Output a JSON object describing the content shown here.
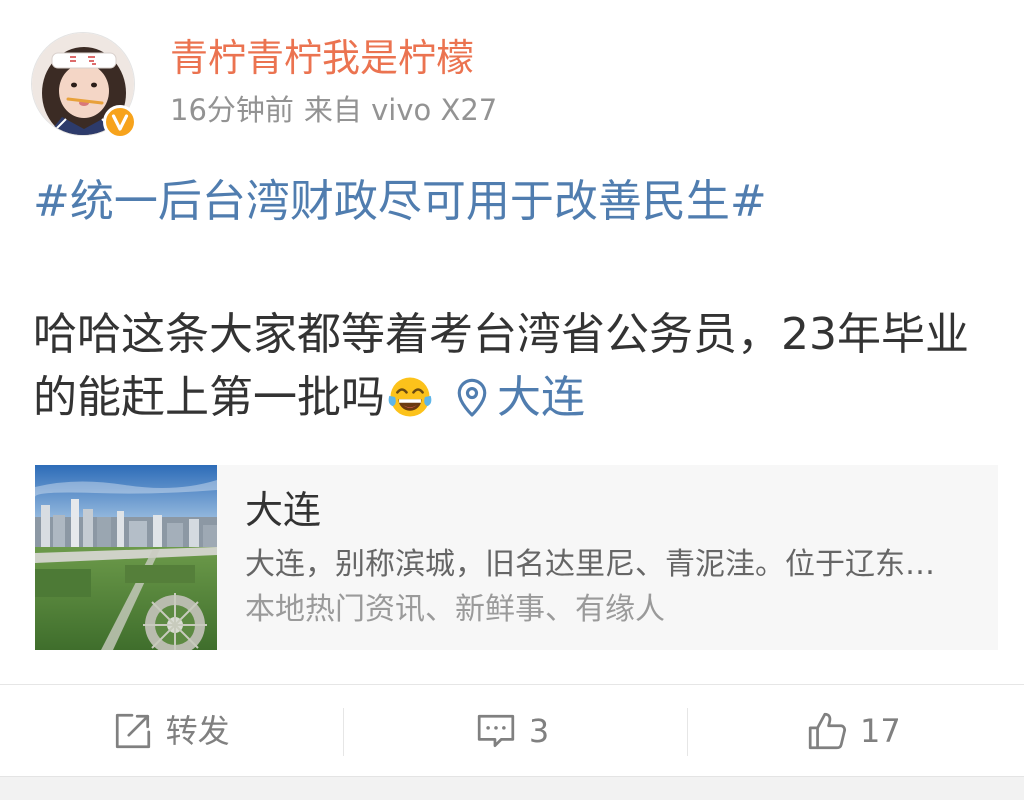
{
  "post": {
    "author": {
      "name": "青柠青柠我是柠檬",
      "avatar_icon": "user-avatar-photo",
      "verified_icon": "verified-badge-icon"
    },
    "meta": {
      "time": "16分钟前",
      "source": "来自 vivo X27"
    },
    "hashtag": "#统一后台湾财政尽可用于改善民生#",
    "body_text": "哈哈这条大家都等着考台湾省公务员，23年毕业的能赶上第一批吗",
    "emoji_icon": "face-with-tears-of-joy-emoji",
    "location": {
      "icon": "location-pin-icon",
      "name": "大连"
    }
  },
  "location_card": {
    "thumbnail_icon": "city-aerial-photo",
    "title": "大连",
    "description": "大连，别称滨城，旧名达里尼、青泥洼。位于辽东…",
    "subtitle": "本地热门资讯、新鲜事、有缘人"
  },
  "actions": {
    "repost": {
      "icon": "repost-icon",
      "label": "转发"
    },
    "comment": {
      "icon": "comment-icon",
      "count": "3"
    },
    "like": {
      "icon": "thumbs-up-icon",
      "count": "17"
    }
  },
  "colors": {
    "username": "#eb7350",
    "link": "#507daf",
    "meta": "#939393",
    "card_background": "#f7f7f7",
    "action": "#808080",
    "verified_badge": "#f7a31c"
  }
}
